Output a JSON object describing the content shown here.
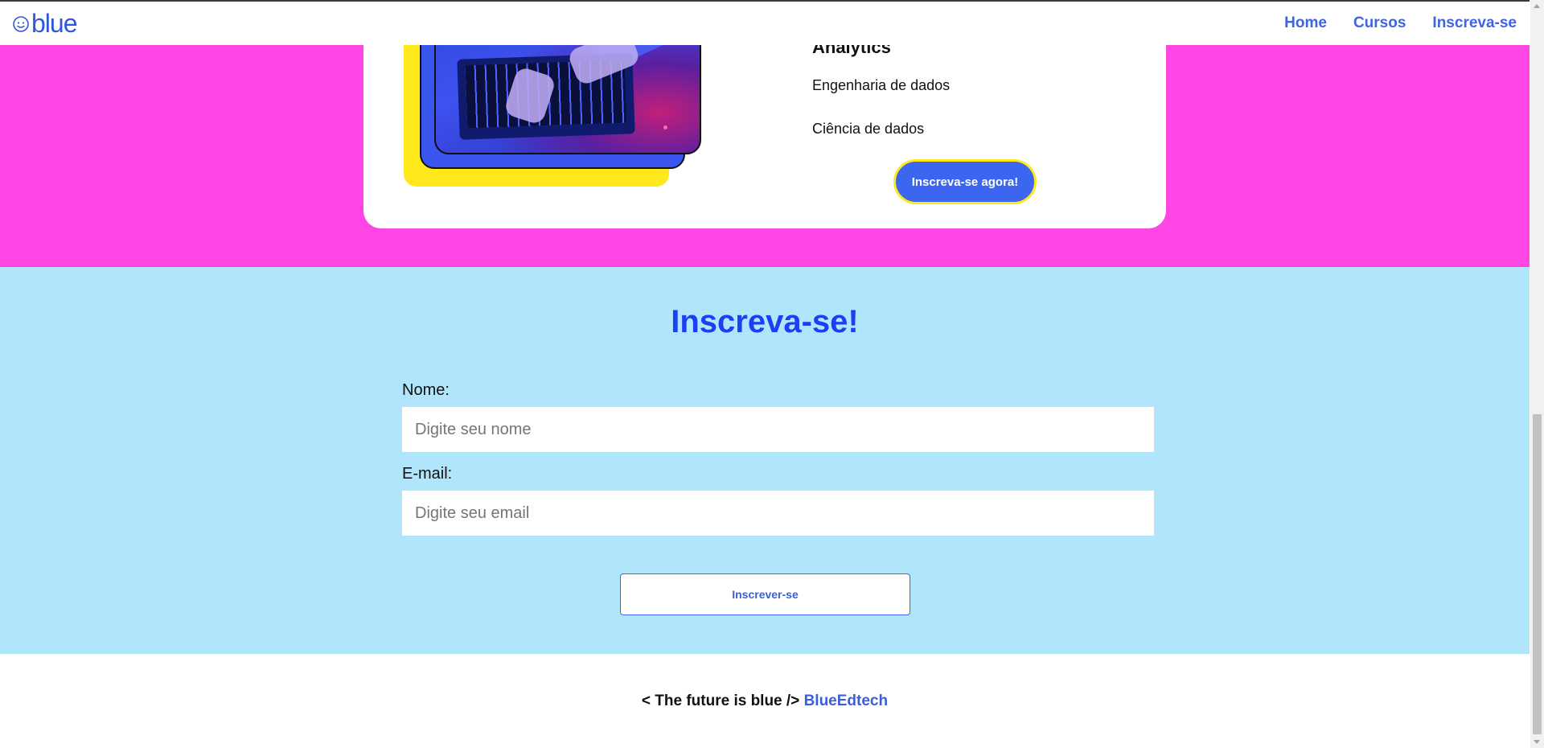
{
  "nav": {
    "logo": "blue",
    "links": [
      "Home",
      "Cursos",
      "Inscreva-se"
    ]
  },
  "course": {
    "title": "Analytics",
    "items": [
      "Engenharia de dados",
      "Ciência de dados"
    ],
    "cta": "Inscreva-se agora!"
  },
  "signup": {
    "title": "Inscreva-se!",
    "name_label": "Nome:",
    "name_placeholder": "Digite seu nome",
    "email_label": "E-mail:",
    "email_placeholder": "Digite seu email",
    "submit": "Inscrever-se"
  },
  "footer": {
    "text": "< The future is blue />",
    "brand": "BlueEdtech"
  },
  "colors": {
    "brand_blue": "#3c66f0",
    "pink": "#ff45e3",
    "light_blue": "#b1e5fb",
    "yellow": "#ffe81c",
    "title_blue": "#1b3ff2"
  },
  "icons": {
    "logo": "smiley-circle-icon"
  }
}
